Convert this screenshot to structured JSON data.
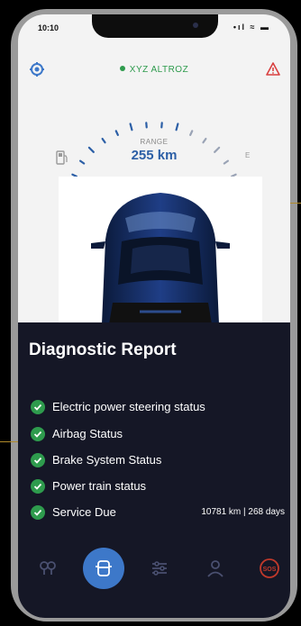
{
  "status_bar": {
    "time": "10:10",
    "icons": "•ıl ≈ ▬"
  },
  "header": {
    "car_name": "XYZ ALTROZ"
  },
  "gauge": {
    "label": "RANGE",
    "value": "255 km",
    "empty_marker": "E"
  },
  "report": {
    "title": "Diagnostic Report",
    "items": [
      {
        "label": "Electric power steering status",
        "value": ""
      },
      {
        "label": "Airbag Status",
        "value": ""
      },
      {
        "label": "Brake System Status",
        "value": ""
      },
      {
        "label": "Power train status",
        "value": ""
      },
      {
        "label": "Service Due",
        "value": "10781 km | 268 days"
      }
    ]
  },
  "nav": {
    "items": [
      {
        "icon": "connected-icon",
        "active": false
      },
      {
        "icon": "car-icon",
        "active": true
      },
      {
        "icon": "sliders-icon",
        "active": false
      },
      {
        "icon": "profile-icon",
        "active": false
      },
      {
        "icon": "sos-icon",
        "active": false
      }
    ],
    "sos_label": "SOS"
  },
  "colors": {
    "accent": "#3d78c9",
    "ok": "#2e9b4d",
    "panel": "#151726",
    "range_text": "#2c5fa6"
  }
}
